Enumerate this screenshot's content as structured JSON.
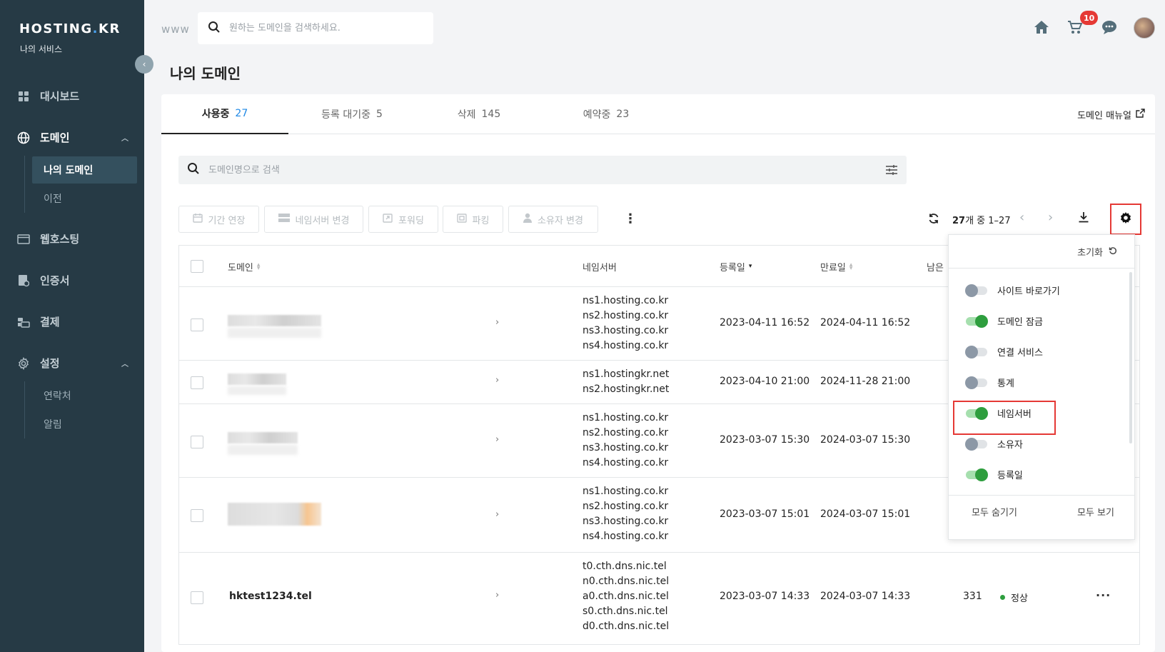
{
  "brand": {
    "logo_main": "HOSTING",
    "logo_dot": ".",
    "logo_end": "KR",
    "subtitle": "나의 서비스"
  },
  "sidebar": {
    "items": [
      {
        "label": "대시보드",
        "icon": "grid-icon"
      },
      {
        "label": "도메인",
        "icon": "globe-icon"
      },
      {
        "label": "웹호스팅",
        "icon": "browser-window-icon"
      },
      {
        "label": "인증서",
        "icon": "certificate-icon"
      },
      {
        "label": "결제",
        "icon": "payment-icon"
      },
      {
        "label": "설정",
        "icon": "gear-icon"
      }
    ],
    "domain_sub": [
      "나의 도메인",
      "이전"
    ],
    "settings_sub": [
      "연락처",
      "알림"
    ]
  },
  "topbar": {
    "www": "www",
    "search_placeholder": "원하는 도메인을 검색하세요.",
    "cart_count": "10"
  },
  "page": {
    "title": "나의 도메인"
  },
  "tabs": [
    {
      "label": "사용중",
      "count": "27"
    },
    {
      "label": "등록 대기중",
      "count": "5"
    },
    {
      "label": "삭제",
      "count": "145"
    },
    {
      "label": "예약중",
      "count": "23"
    }
  ],
  "manual_link": "도메인 매뉴얼",
  "table_search_placeholder": "도메인명으로 검색",
  "actions": [
    "기간 연장",
    "네임서버 변경",
    "포워딩",
    "파킹",
    "소유자 변경"
  ],
  "pagination": {
    "total": "27",
    "total_suffix": "개 중 1–27"
  },
  "columns": {
    "domain": "도메인",
    "nameserver": "네임서버",
    "registered": "등록일",
    "expires": "만료일",
    "remaining": "남은"
  },
  "rows": [
    {
      "domain": "",
      "ns": [
        "ns1.hosting.co.kr",
        "ns2.hosting.co.kr",
        "ns3.hosting.co.kr",
        "ns4.hosting.co.kr"
      ],
      "registered": "2023-04-11 16:52",
      "expires": "2024-04-11 16:52"
    },
    {
      "domain": "",
      "ns": [
        "ns1.hostingkr.net",
        "ns2.hostingkr.net"
      ],
      "registered": "2023-04-10 21:00",
      "expires": "2024-11-28 21:00"
    },
    {
      "domain": "",
      "ns": [
        "ns1.hosting.co.kr",
        "ns2.hosting.co.kr",
        "ns3.hosting.co.kr",
        "ns4.hosting.co.kr"
      ],
      "registered": "2023-03-07 15:30",
      "expires": "2024-03-07 15:30"
    },
    {
      "domain": "",
      "ns": [
        "ns1.hosting.co.kr",
        "ns2.hosting.co.kr",
        "ns3.hosting.co.kr",
        "ns4.hosting.co.kr"
      ],
      "registered": "2023-03-07 15:01",
      "expires": "2024-03-07 15:01"
    },
    {
      "domain": "hktest1234.tel",
      "ns": [
        "t0.cth.dns.nic.tel",
        "n0.cth.dns.nic.tel",
        "a0.cth.dns.nic.tel",
        "s0.cth.dns.nic.tel",
        "d0.cth.dns.nic.tel"
      ],
      "registered": "2023-03-07 14:33",
      "expires": "2024-03-07 14:33",
      "remaining": "331",
      "status": "정상"
    }
  ],
  "column_settings": {
    "reset_label": "초기화",
    "options": [
      {
        "label": "사이트 바로가기",
        "on": false
      },
      {
        "label": "도메인 잠금",
        "on": true
      },
      {
        "label": "연결 서비스",
        "on": false
      },
      {
        "label": "통계",
        "on": false
      },
      {
        "label": "네임서버",
        "on": true
      },
      {
        "label": "소유자",
        "on": false
      },
      {
        "label": "등록일",
        "on": true
      }
    ],
    "hide_all": "모두 숨기기",
    "show_all": "모두 보기"
  },
  "colors": {
    "sidebar_bg": "#263a45",
    "accent_blue": "#1e88e5",
    "toggle_on": "#2e9e3e",
    "highlight_red": "#e53935"
  }
}
